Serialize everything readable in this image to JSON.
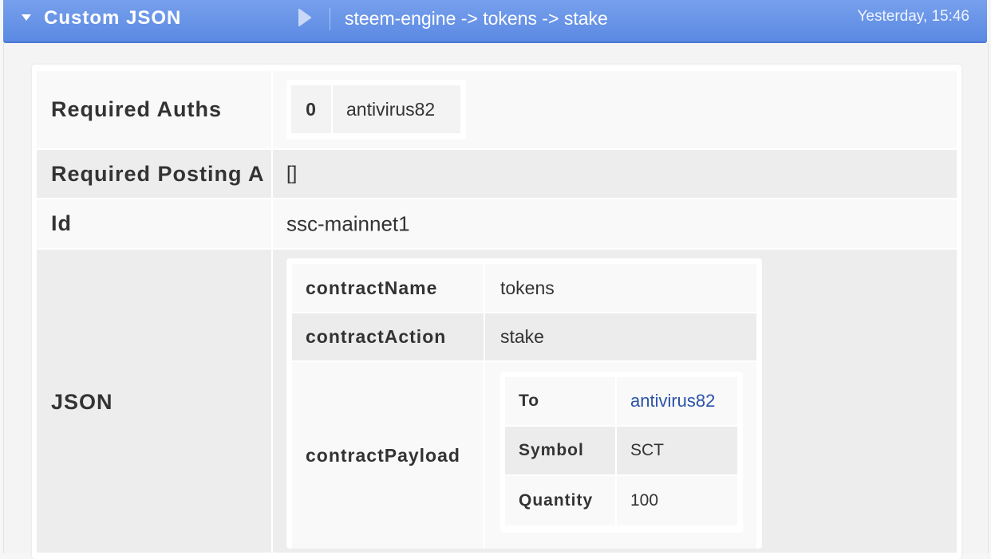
{
  "header": {
    "title": "Custom JSON",
    "summary": "steem-engine -> tokens -> stake",
    "time": "Yesterday, 15:46"
  },
  "rows": {
    "required_auths": {
      "key": "Required Auths",
      "items": [
        {
          "index": "0",
          "value": "antivirus82"
        }
      ]
    },
    "required_posting_auths": {
      "key": "Required Posting A",
      "value": "[]"
    },
    "id": {
      "key": "Id",
      "value": "ssc-mainnet1"
    },
    "json": {
      "key": "JSON"
    }
  },
  "json": {
    "contract_name": {
      "key": "contractName",
      "value": "tokens"
    },
    "contract_action": {
      "key": "contractAction",
      "value": "stake"
    },
    "contract_payload": {
      "key": "contractPayload",
      "to": {
        "key": "To",
        "value": "antivirus82"
      },
      "symbol": {
        "key": "Symbol",
        "value": "SCT"
      },
      "quantity": {
        "key": "Quantity",
        "value": "100"
      }
    }
  },
  "colors": {
    "header_bg": "#6792e8",
    "link": "#2a52a8"
  },
  "icons": [
    "caret-down-icon",
    "play-icon"
  ]
}
